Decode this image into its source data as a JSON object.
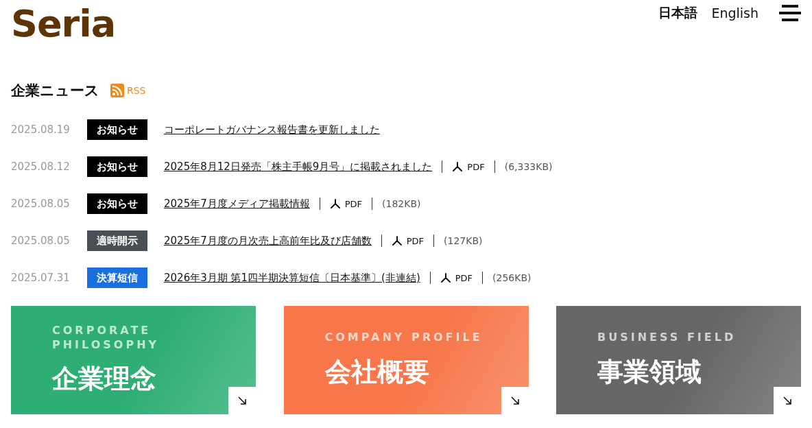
{
  "header": {
    "logo": "Seria",
    "languages": [
      {
        "label": "日本語",
        "selected": true
      },
      {
        "label": "English",
        "selected": false
      }
    ]
  },
  "news": {
    "title": "企業ニュース",
    "rss": "RSS",
    "items": [
      {
        "date": "2025.08.19",
        "tag": "お知らせ",
        "color": "#000000",
        "title": "コーポレートガバナンス報告書を更新しました"
      },
      {
        "date": "2025.08.12",
        "tag": "お知らせ",
        "color": "#000000",
        "title": "2025年8月12日発売「株主手帳9月号」に掲載されました",
        "file": "PDF",
        "size": "(6,333KB)"
      },
      {
        "date": "2025.08.05",
        "tag": "お知らせ",
        "color": "#000000",
        "title": "2025年7月度メディア掲載情報",
        "file": "PDF",
        "size": "(182KB)"
      },
      {
        "date": "2025.08.05",
        "tag": "適時開示",
        "color": "#4a4f55",
        "title": "2025年7月度の月次売上高前年比及び店舗数",
        "file": "PDF",
        "size": "(127KB)"
      },
      {
        "date": "2025.07.31",
        "tag": "決算短信",
        "color": "#1a6fe0",
        "title": "2026年3月期 第1四半期決算短信〔日本基準〕(非連結)",
        "file": "PDF",
        "size": "(256KB)"
      }
    ]
  },
  "cards": [
    {
      "eyebrow": "CORPORATE PHILOSOPHY",
      "title": "企業理念",
      "color": "#2eae74"
    },
    {
      "eyebrow": "COMPANY PROFILE",
      "title": "会社概要",
      "color": "#f7774a"
    },
    {
      "eyebrow": "BUSINESS FIELD",
      "title": "事業領域",
      "color": "#666666"
    }
  ]
}
